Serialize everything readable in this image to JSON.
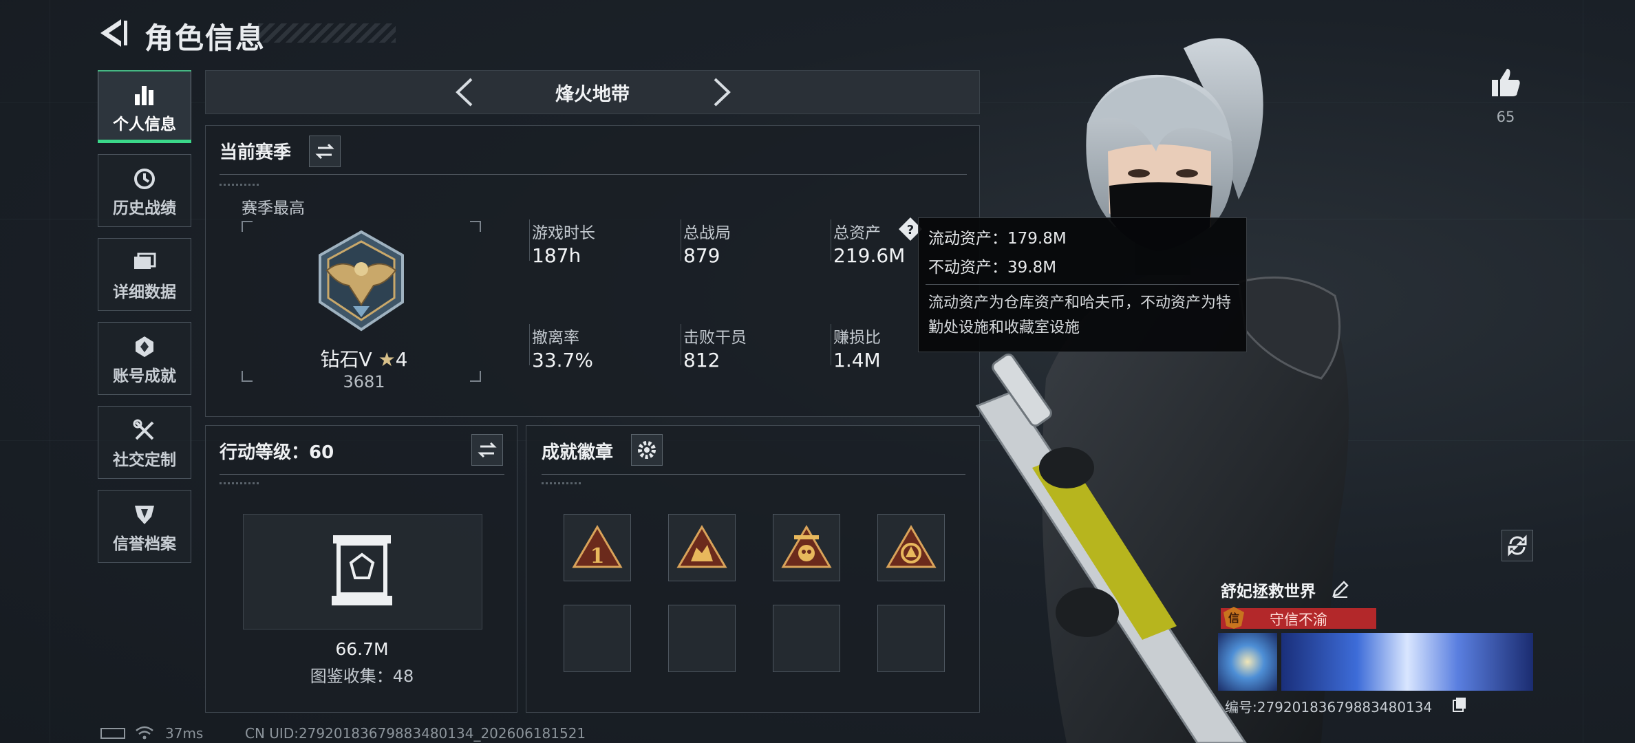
{
  "header": {
    "title": "角色信息"
  },
  "sidebar": {
    "items": [
      {
        "label": "个人信息",
        "icon": "bar-chart-icon"
      },
      {
        "label": "历史战绩",
        "icon": "history-clock-icon"
      },
      {
        "label": "详细数据",
        "icon": "data-cards-icon"
      },
      {
        "label": "账号成就",
        "icon": "achievement-medal-icon"
      },
      {
        "label": "社交定制",
        "icon": "wrench-screwdriver-icon"
      },
      {
        "label": "信誉档案",
        "icon": "shield-emblem-icon"
      }
    ]
  },
  "mode": {
    "name": "烽火地带"
  },
  "season": {
    "title": "当前赛季",
    "best_label": "赛季最高",
    "rank_name": "钻石V",
    "rank_stars": "4",
    "rank_score": "3681",
    "stats": [
      {
        "label": "游戏时长",
        "value": "187h"
      },
      {
        "label": "总战局",
        "value": "879"
      },
      {
        "label": "总资产",
        "value": "219.6M"
      },
      {
        "label": "撤离率",
        "value": "33.7%"
      },
      {
        "label": "击败干员",
        "value": "812"
      },
      {
        "label": "赚损比",
        "value": "1.4M"
      }
    ]
  },
  "tooltip": {
    "line1": "流动资产：179.8M",
    "line2": "不动资产：39.8M",
    "desc": "流动资产为仓库资产和哈夫币，不动资产为特勤处设施和收藏室设施"
  },
  "action_level": {
    "title": "行动等级：60",
    "value": "66.7M",
    "collection": "图鉴收集：48"
  },
  "badges": {
    "title": "成就徽章"
  },
  "likes": {
    "count": "65"
  },
  "player": {
    "name": "舒妃拯救世界",
    "tag": "守信不渝",
    "id_line": "编号:27920183679883480134"
  },
  "status_bar": {
    "ping": "37ms",
    "uid": "CN UID:27920183679883480134_202606181521"
  },
  "colors": {
    "accent": "#3bd88a",
    "tag_red": "#b3282a"
  }
}
